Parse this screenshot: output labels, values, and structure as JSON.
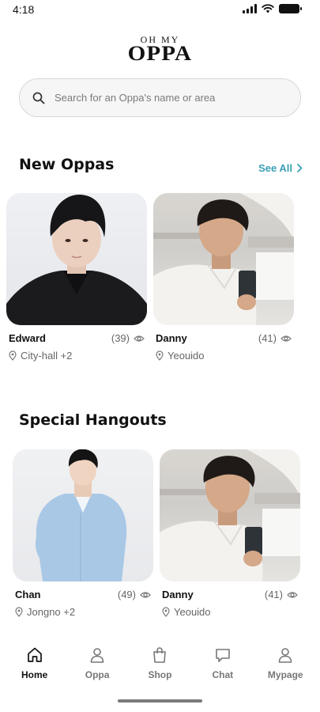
{
  "status_bar": {
    "time": "4:18"
  },
  "logo": {
    "top": "OH MY",
    "main": "OPPA"
  },
  "search": {
    "placeholder": "Search for an Oppa's name or area"
  },
  "new_oppas": {
    "title": "New Oppas",
    "see_all": "See All",
    "cards": [
      {
        "name": "Edward",
        "views": "(39)",
        "location": "City-hall +2"
      },
      {
        "name": "Danny",
        "views": "(41)",
        "location": "Yeouido"
      }
    ]
  },
  "special_hangouts": {
    "title": "Special Hangouts",
    "cards": [
      {
        "name": "Chan",
        "views": "(49)",
        "location": "Jongno +2"
      },
      {
        "name": "Danny",
        "views": "(41)",
        "location": "Yeouido"
      }
    ]
  },
  "nav": {
    "items": [
      {
        "label": "Home",
        "icon": "home-icon",
        "active": true
      },
      {
        "label": "Oppa",
        "icon": "person-icon",
        "active": false
      },
      {
        "label": "Shop",
        "icon": "shopping-bag-icon",
        "active": false
      },
      {
        "label": "Chat",
        "icon": "chat-bubble-icon",
        "active": false
      },
      {
        "label": "Mypage",
        "icon": "user-icon",
        "active": false
      }
    ]
  },
  "colors": {
    "accent": "#3a9fb5",
    "text": "#111111",
    "muted": "#666666"
  }
}
